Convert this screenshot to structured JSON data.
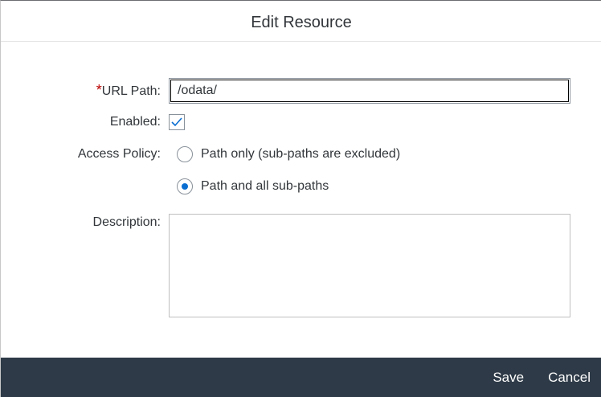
{
  "dialog": {
    "title": "Edit Resource"
  },
  "form": {
    "url_path": {
      "required_marker": "*",
      "label": "URL Path:",
      "value": "/odata/"
    },
    "enabled": {
      "label": "Enabled:",
      "checked": true,
      "check_icon": "checkmark-icon"
    },
    "access_policy": {
      "label": "Access Policy:",
      "options": [
        {
          "label": "Path only (sub-paths are excluded)",
          "selected": false
        },
        {
          "label": "Path and all sub-paths",
          "selected": true
        }
      ]
    },
    "description": {
      "label": "Description:",
      "value": ""
    }
  },
  "footer": {
    "save_label": "Save",
    "cancel_label": "Cancel"
  },
  "colors": {
    "accent": "#0a6ed1",
    "required": "#bb0000",
    "footer_bg": "#2e3a47",
    "text": "#32363a"
  }
}
